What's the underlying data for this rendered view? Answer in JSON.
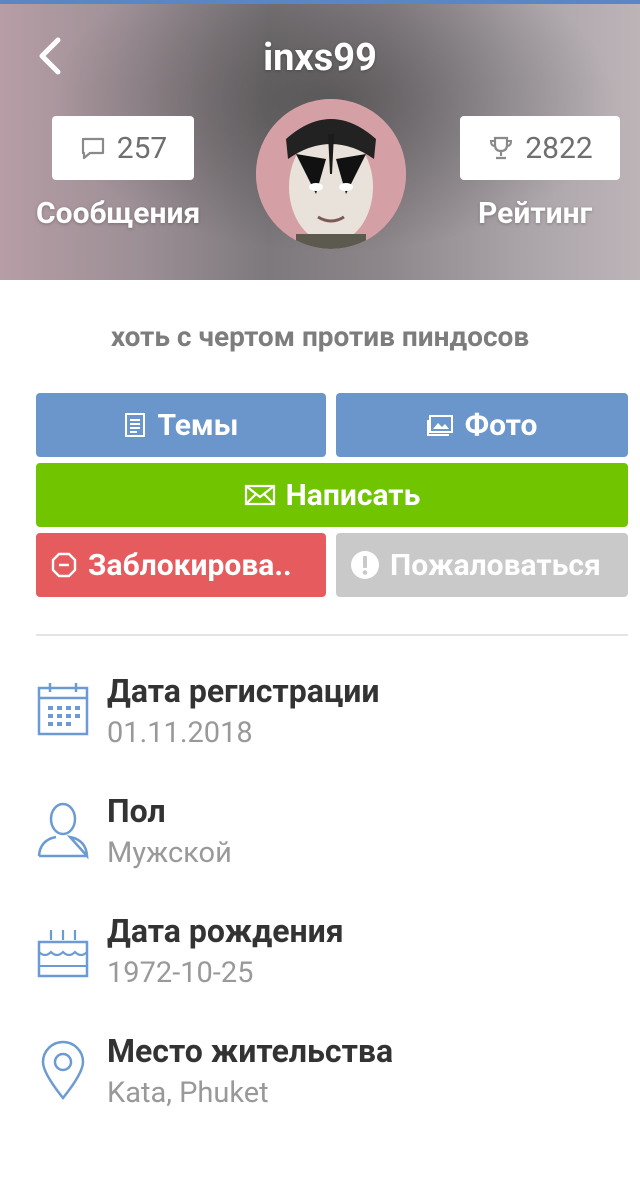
{
  "header": {
    "username": "inxs99",
    "messages_count": "257",
    "messages_label": "Сообщения",
    "rating_count": "2822",
    "rating_label": "Рейтинг"
  },
  "status_text": "хоть с чертом против пиндосов",
  "buttons": {
    "topics": "Темы",
    "photo": "Фото",
    "write": "Написать",
    "block": "Заблокирова..",
    "report": "Пожаловаться"
  },
  "info": [
    {
      "icon": "calendar-icon",
      "title": "Дата регистрации",
      "value": "01.11.2018"
    },
    {
      "icon": "person-icon",
      "title": "Пол",
      "value": "Мужской"
    },
    {
      "icon": "cake-icon",
      "title": "Дата рождения",
      "value": "1972-10-25"
    },
    {
      "icon": "location-pin-icon",
      "title": "Место жительства",
      "value": "Kata, Phuket"
    }
  ],
  "colors": {
    "accent_blue": "#6b96cc",
    "write_green": "#71c400",
    "block_red": "#e55b5e",
    "report_grey": "#c9c9c9",
    "icon_blue": "#6b9bd2"
  }
}
